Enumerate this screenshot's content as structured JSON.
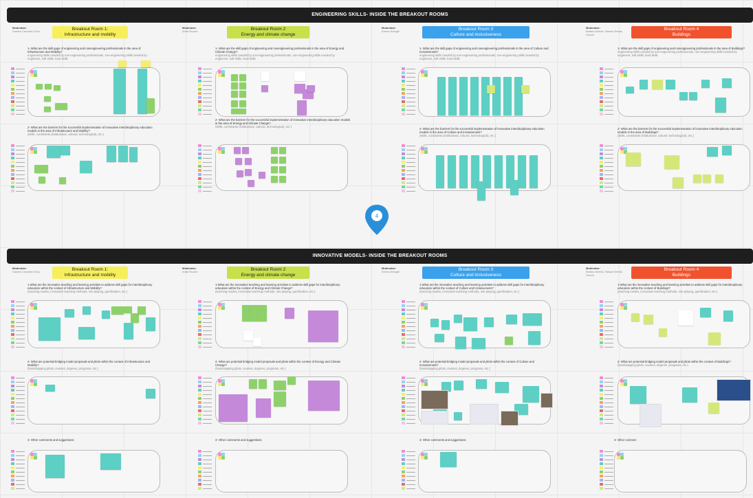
{
  "sections": {
    "top": {
      "title": "ENGINEERING SKILLS- INSIDE THE BREAKOUT ROOMS"
    },
    "bottom": {
      "title": "INNOVATIVE MODELS- INSIDE THE BREAKOUT ROOMS"
    }
  },
  "moderator_label": "Moderator:",
  "rooms": [
    {
      "title_line1": "Breakout Room 1:",
      "title_line2": "Infrastructure and mobility",
      "color": "#f7ef5a",
      "moderator": "Sandra Carvalho Gutu"
    },
    {
      "title_line1": "Breakout Room 2",
      "title_line2": "Energy and climate change",
      "color": "#c8e04a",
      "moderator": "Anita Ruzzle"
    },
    {
      "title_line1": "Breakout Room 3",
      "title_line2": "Culture and inclusiveness",
      "color": "#3aa1ec",
      "moderator": "Emma Shingle"
    },
    {
      "title_line1": "Breakout Room 4",
      "title_line2": "Buildings",
      "color": "#f0522e",
      "moderator": "Beatriz Arteira / Basak Selmis Ozturk"
    }
  ],
  "top_questions": {
    "q1": [
      {
        "text": "1- What are the skill gaps of engineering and nonengineering professionals in the area of Infrastructure and Mobility?",
        "sub": "engineering skills needed by non-engineering professionals, non-engineering skills needed by engineers, soft skills, hard skills"
      },
      {
        "text": "1- What are the skill gaps of engineering and nonengineering professionals in the area of Energy and Climate Change?",
        "sub": "engineering skills needed by non-engineering professionals, non-engineering skills needed by engineers, soft skills, hard skills"
      },
      {
        "text": "1- What are the skill gaps of engineering and nonengineering professionals in the area of Culture and Inclusiveness?",
        "sub": "engineering skills needed by non-engineering professionals, non-engineering skills needed by engineers, soft skills, hard skills"
      },
      {
        "text": "1- What are the skill gaps of engineering and nonengineering professionals in the area of Buildings?",
        "sub": "engineering skills needed by non-engineering professionals, non-engineering skills needed by engineers, soft skills, hard skills"
      }
    ],
    "q2": [
      {
        "text": "2- What are the barriers for the successful implementation of innovative interdisciplinary education models in the area of Infrastructure and Mobility?",
        "sub": "(skills, constraints (institutional, cultural, technological), etc.)"
      },
      {
        "text": "2- What are the barriers for the successful implementation of innovative interdisciplinary education models in the area of Energy and Climate Change?",
        "sub": "(skills, constraints (institutional, cultural, technological), etc.)"
      },
      {
        "text": "2- What are the barriers for the successful implementation of innovative interdisciplinary education models in the area of Culture and Inclusiveness?",
        "sub": "(skills, constraints (institutional, cultural, technological), etc.)"
      },
      {
        "text": "2- What are the barriers for the successful implementation of innovative interdisciplinary education models in the area of Buildings?",
        "sub": "(skills, constraints (institutional, cultural, technological), etc.)"
      }
    ]
  },
  "bottom_questions": {
    "q1": [
      {
        "text": "1-What are the innovative teaching and learning activities to address skill gaps for interdisciplinary education within the context of Infrastructure and Mobility?",
        "sub": "(teaching modes, innovative teaching methods, role playing, gamification, etc.)"
      },
      {
        "text": "1-What are the innovative teaching and learning activities to address skill gaps for interdisciplinary education within the context of Energy and Climate Change?",
        "sub": "(teaching modes, innovative teaching methods, role playing, gamification, etc.)"
      },
      {
        "text": "1-What are the innovative teaching and learning activities to address skill gaps for interdisciplinary education within the context of Culture and Inclusiveness?",
        "sub": "(teaching modes, innovative teaching methods, role playing, gamification, etc.)"
      },
      {
        "text": "1-What are the innovative teaching and learning activities to address skill gaps for interdisciplinary education within the context of Buildings?",
        "sub": "(teaching modes, innovative teaching methods, role playing, gamification, etc.)"
      }
    ],
    "q2": [
      {
        "text": "2- What are potential bridging model proposals and pilots within the context of Infrastructure and Mobility?",
        "sub": "(bootstrapping pilots, courses, degrees, programs, etc.)"
      },
      {
        "text": "2- What are potential bridging model proposals and pilots within the context of Energy and Climate Change?",
        "sub": "(bootstrapping pilots, courses, degrees, programs, etc.)"
      },
      {
        "text": "2- What are potential bridging model proposals and pilots within the context of Culture and Inclusiveness?",
        "sub": "(bootstrapping pilots, courses, degrees, programs, etc.)"
      },
      {
        "text": "2- What are potential bridging model proposals and pilots within the context of Buildings?",
        "sub": "(bootstrapping pilots, courses, degrees, programs, etc.)"
      }
    ],
    "q3": [
      {
        "text": "3- Other comments and suggestions"
      },
      {
        "text": "3- Other comments and suggestions"
      },
      {
        "text": "3- Other comments and suggestions"
      },
      {
        "text": "3- Other commen"
      }
    ]
  },
  "pin": {
    "label": "4",
    "color": "#2a8fd9"
  },
  "colors": {
    "teal": "#5ecfc4",
    "green": "#8ed16a",
    "purple": "#c48ad9",
    "lime": "#d4e87a",
    "yellow": "#f6ec6f"
  },
  "icons": [
    "map-pin-icon",
    "participant-logo-icon"
  ]
}
